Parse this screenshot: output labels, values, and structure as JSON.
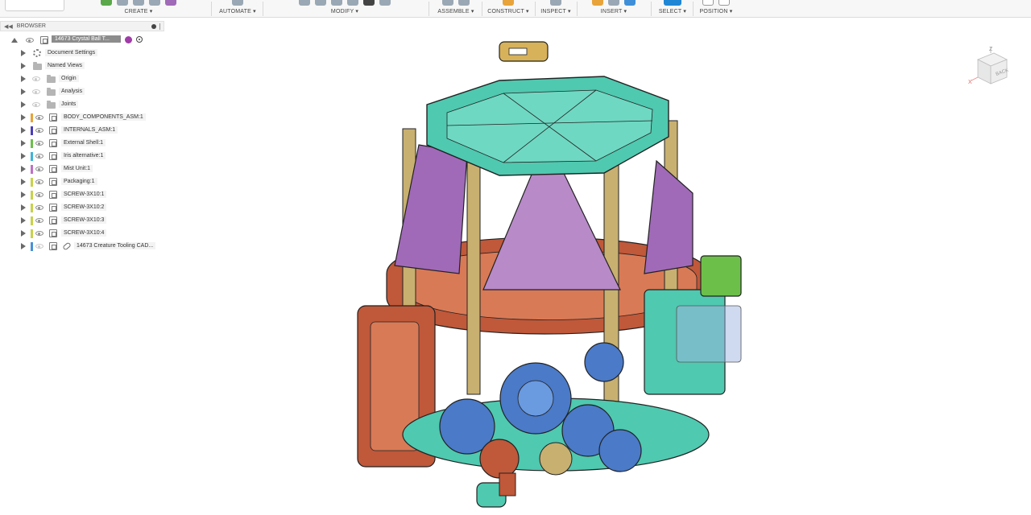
{
  "toolbar": {
    "groups": [
      {
        "label": "CREATE ▾"
      },
      {
        "label": "AUTOMATE ▾"
      },
      {
        "label": "MODIFY ▾"
      },
      {
        "label": "ASSEMBLE ▾"
      },
      {
        "label": "CONSTRUCT ▾"
      },
      {
        "label": "INSPECT ▾"
      },
      {
        "label": "INSERT ▾"
      },
      {
        "label": "SELECT ▾"
      },
      {
        "label": "POSITION ▾"
      }
    ]
  },
  "browser": {
    "title": "BROWSER",
    "root": "14673 Crystal Ball T...",
    "items": [
      {
        "label": "Document Settings",
        "color": ""
      },
      {
        "label": "Named Views",
        "color": ""
      },
      {
        "label": "Origin",
        "color": ""
      },
      {
        "label": "Analysis",
        "color": ""
      },
      {
        "label": "Joints",
        "color": ""
      },
      {
        "label": "BODY_COMPONENTS_ASM:1",
        "color": "#e8a33a"
      },
      {
        "label": "INTERNALS_ASM:1",
        "color": "#4a3fb8"
      },
      {
        "label": "External Shell:1",
        "color": "#6cc04a"
      },
      {
        "label": "Iris alternative:1",
        "color": "#3fb3d8"
      },
      {
        "label": "Mist Unit:1",
        "color": "#c070c8"
      },
      {
        "label": "Packaging:1",
        "color": "#c8d24a"
      },
      {
        "label": "SCREW-3X10:1",
        "color": "#c8d24a"
      },
      {
        "label": "SCREW-3X10:2",
        "color": "#c8d24a"
      },
      {
        "label": "SCREW-3X10:3",
        "color": "#c8d24a"
      },
      {
        "label": "SCREW-3X10:4",
        "color": "#c8d24a"
      },
      {
        "label": "14673 Creature Tooling CAD...",
        "color": "#4a90d8"
      }
    ]
  },
  "viewcube": {
    "face": "BACK",
    "axis_z": "Z",
    "axis_x": "X"
  },
  "colors": {
    "teal": "#4fc9b0",
    "rust": "#c0583a",
    "purple": "#a06ab8",
    "tan": "#c8b070",
    "blue": "#4a7ac8",
    "green": "#6cc04a"
  }
}
